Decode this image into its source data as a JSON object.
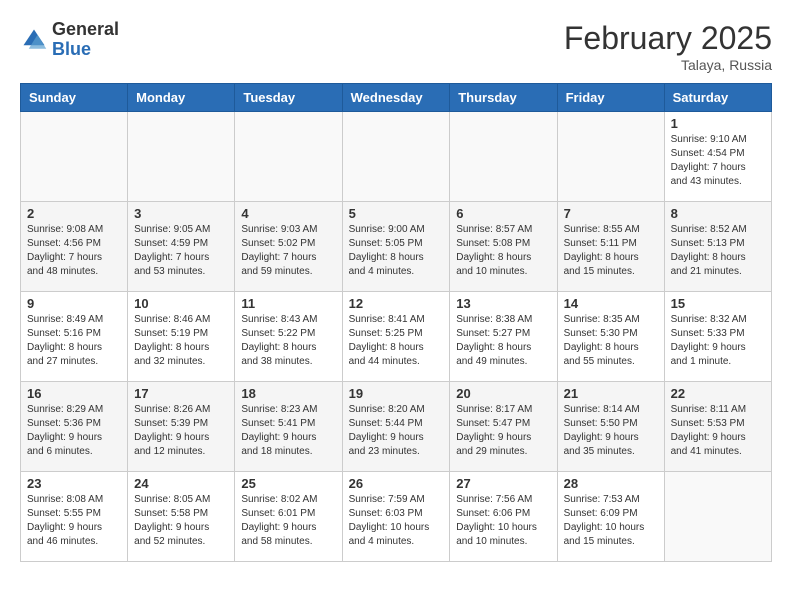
{
  "header": {
    "logo_general": "General",
    "logo_blue": "Blue",
    "month_title": "February 2025",
    "location": "Talaya, Russia"
  },
  "days_of_week": [
    "Sunday",
    "Monday",
    "Tuesday",
    "Wednesday",
    "Thursday",
    "Friday",
    "Saturday"
  ],
  "weeks": [
    [
      {
        "day": "",
        "info": ""
      },
      {
        "day": "",
        "info": ""
      },
      {
        "day": "",
        "info": ""
      },
      {
        "day": "",
        "info": ""
      },
      {
        "day": "",
        "info": ""
      },
      {
        "day": "",
        "info": ""
      },
      {
        "day": "1",
        "info": "Sunrise: 9:10 AM\nSunset: 4:54 PM\nDaylight: 7 hours\nand 43 minutes."
      }
    ],
    [
      {
        "day": "2",
        "info": "Sunrise: 9:08 AM\nSunset: 4:56 PM\nDaylight: 7 hours\nand 48 minutes."
      },
      {
        "day": "3",
        "info": "Sunrise: 9:05 AM\nSunset: 4:59 PM\nDaylight: 7 hours\nand 53 minutes."
      },
      {
        "day": "4",
        "info": "Sunrise: 9:03 AM\nSunset: 5:02 PM\nDaylight: 7 hours\nand 59 minutes."
      },
      {
        "day": "5",
        "info": "Sunrise: 9:00 AM\nSunset: 5:05 PM\nDaylight: 8 hours\nand 4 minutes."
      },
      {
        "day": "6",
        "info": "Sunrise: 8:57 AM\nSunset: 5:08 PM\nDaylight: 8 hours\nand 10 minutes."
      },
      {
        "day": "7",
        "info": "Sunrise: 8:55 AM\nSunset: 5:11 PM\nDaylight: 8 hours\nand 15 minutes."
      },
      {
        "day": "8",
        "info": "Sunrise: 8:52 AM\nSunset: 5:13 PM\nDaylight: 8 hours\nand 21 minutes."
      }
    ],
    [
      {
        "day": "9",
        "info": "Sunrise: 8:49 AM\nSunset: 5:16 PM\nDaylight: 8 hours\nand 27 minutes."
      },
      {
        "day": "10",
        "info": "Sunrise: 8:46 AM\nSunset: 5:19 PM\nDaylight: 8 hours\nand 32 minutes."
      },
      {
        "day": "11",
        "info": "Sunrise: 8:43 AM\nSunset: 5:22 PM\nDaylight: 8 hours\nand 38 minutes."
      },
      {
        "day": "12",
        "info": "Sunrise: 8:41 AM\nSunset: 5:25 PM\nDaylight: 8 hours\nand 44 minutes."
      },
      {
        "day": "13",
        "info": "Sunrise: 8:38 AM\nSunset: 5:27 PM\nDaylight: 8 hours\nand 49 minutes."
      },
      {
        "day": "14",
        "info": "Sunrise: 8:35 AM\nSunset: 5:30 PM\nDaylight: 8 hours\nand 55 minutes."
      },
      {
        "day": "15",
        "info": "Sunrise: 8:32 AM\nSunset: 5:33 PM\nDaylight: 9 hours\nand 1 minute."
      }
    ],
    [
      {
        "day": "16",
        "info": "Sunrise: 8:29 AM\nSunset: 5:36 PM\nDaylight: 9 hours\nand 6 minutes."
      },
      {
        "day": "17",
        "info": "Sunrise: 8:26 AM\nSunset: 5:39 PM\nDaylight: 9 hours\nand 12 minutes."
      },
      {
        "day": "18",
        "info": "Sunrise: 8:23 AM\nSunset: 5:41 PM\nDaylight: 9 hours\nand 18 minutes."
      },
      {
        "day": "19",
        "info": "Sunrise: 8:20 AM\nSunset: 5:44 PM\nDaylight: 9 hours\nand 23 minutes."
      },
      {
        "day": "20",
        "info": "Sunrise: 8:17 AM\nSunset: 5:47 PM\nDaylight: 9 hours\nand 29 minutes."
      },
      {
        "day": "21",
        "info": "Sunrise: 8:14 AM\nSunset: 5:50 PM\nDaylight: 9 hours\nand 35 minutes."
      },
      {
        "day": "22",
        "info": "Sunrise: 8:11 AM\nSunset: 5:53 PM\nDaylight: 9 hours\nand 41 minutes."
      }
    ],
    [
      {
        "day": "23",
        "info": "Sunrise: 8:08 AM\nSunset: 5:55 PM\nDaylight: 9 hours\nand 46 minutes."
      },
      {
        "day": "24",
        "info": "Sunrise: 8:05 AM\nSunset: 5:58 PM\nDaylight: 9 hours\nand 52 minutes."
      },
      {
        "day": "25",
        "info": "Sunrise: 8:02 AM\nSunset: 6:01 PM\nDaylight: 9 hours\nand 58 minutes."
      },
      {
        "day": "26",
        "info": "Sunrise: 7:59 AM\nSunset: 6:03 PM\nDaylight: 10 hours\nand 4 minutes."
      },
      {
        "day": "27",
        "info": "Sunrise: 7:56 AM\nSunset: 6:06 PM\nDaylight: 10 hours\nand 10 minutes."
      },
      {
        "day": "28",
        "info": "Sunrise: 7:53 AM\nSunset: 6:09 PM\nDaylight: 10 hours\nand 15 minutes."
      },
      {
        "day": "",
        "info": ""
      }
    ]
  ]
}
